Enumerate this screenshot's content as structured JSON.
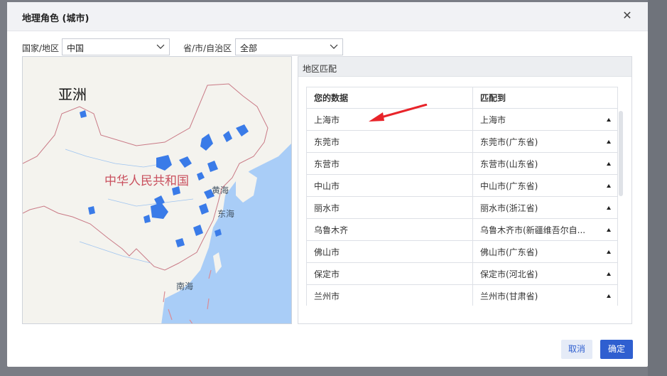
{
  "dialog": {
    "title": "地理角色 (城市)",
    "close_icon": "close-icon"
  },
  "filters": {
    "country_label": "国家/地区",
    "country_value": "中国",
    "province_label": "省/市/自治区",
    "province_value": "全部"
  },
  "map": {
    "continent_label": "亚洲",
    "country_label": "中华人民共和国",
    "sea_labels": [
      "黄海",
      "东海",
      "南海"
    ]
  },
  "panel": {
    "title": "地区匹配",
    "columns": [
      "您的数据",
      "匹配到"
    ],
    "rows": [
      {
        "data": "上海市",
        "match": "上海市"
      },
      {
        "data": "东莞市",
        "match": "东莞市(广东省)"
      },
      {
        "data": "东营市",
        "match": "东营市(山东省)"
      },
      {
        "data": "中山市",
        "match": "中山市(广东省)"
      },
      {
        "data": "丽水市",
        "match": "丽水市(浙江省)"
      },
      {
        "data": "乌鲁木齐",
        "match": "乌鲁木齐市(新疆维吾尔自..."
      },
      {
        "data": "佛山市",
        "match": "佛山市(广东省)"
      },
      {
        "data": "保定市",
        "match": "保定市(河北省)"
      },
      {
        "data": "兰州市",
        "match": "兰州市(甘肃省)"
      }
    ]
  },
  "buttons": {
    "cancel": "取消",
    "ok": "确定"
  },
  "colors": {
    "accent": "#2f5fd0",
    "sea": "#a9cdf7",
    "land": "#f4f3ee",
    "highlight_region": "#3a7be8",
    "arrow": "#e8242a"
  }
}
